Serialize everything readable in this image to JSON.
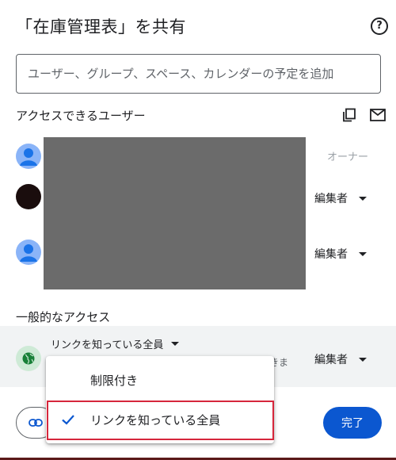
{
  "dialog": {
    "title": "「在庫管理表」を共有",
    "help_icon": "help-circle-icon",
    "help_glyph": "?"
  },
  "share_input": {
    "placeholder": "ユーザー、グループ、スペース、カレンダーの予定を追加",
    "value": ""
  },
  "people_section": {
    "heading": "アクセスできるユーザー",
    "icons": [
      "copy-icon",
      "mail-icon"
    ],
    "people": [
      {
        "avatar": "default-avatar-icon",
        "role": "オーナー"
      },
      {
        "avatar": "dark-avatar",
        "role": "編集者"
      },
      {
        "avatar": "default-avatar-icon",
        "role": "編集者"
      }
    ]
  },
  "general_access": {
    "heading": "一般的なアクセス",
    "link_setting": "リンクを知っている全員",
    "description_partial": "きま",
    "role": "編集者"
  },
  "dropdown_menu": {
    "items": [
      {
        "label": "制限付き",
        "selected": false
      },
      {
        "label": "リンクを知っている全員",
        "selected": true
      }
    ]
  },
  "footer": {
    "copy_link_icon": "link-icon",
    "done_label": "完了"
  },
  "colors": {
    "primary": "#0b57d0",
    "highlight": "#d6263b",
    "globe_bg": "#ceead6",
    "globe": "#188038"
  }
}
